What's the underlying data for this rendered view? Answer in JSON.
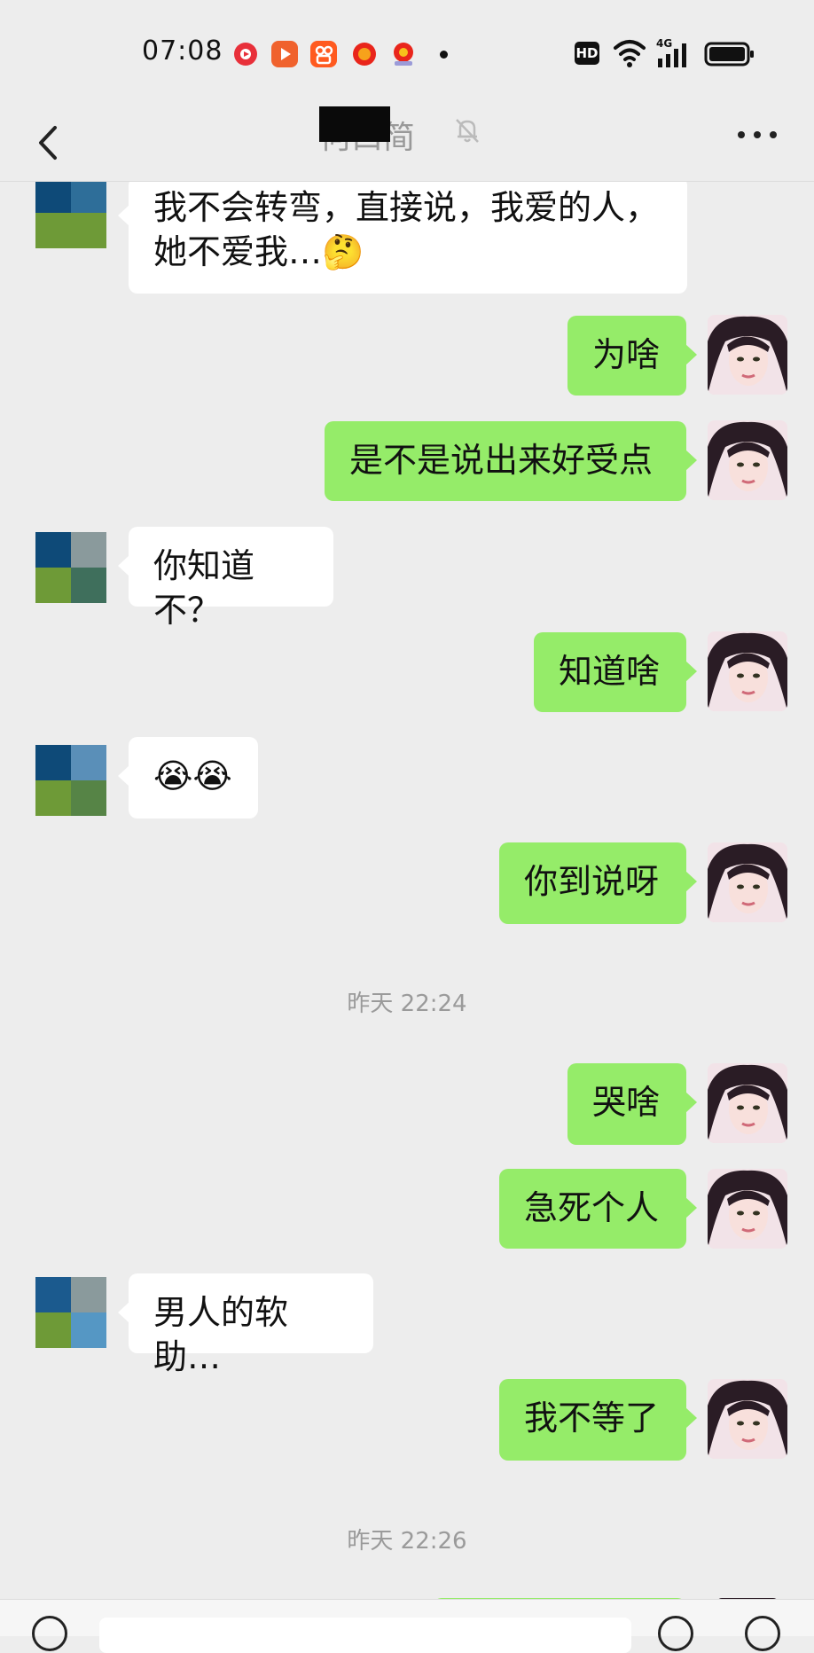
{
  "status_bar": {
    "time": "07:08",
    "network": "4G",
    "hd_label": "HD",
    "icons": [
      "video-app-icon",
      "play-app-icon",
      "kuaishou-app-icon",
      "shopping-app-icon",
      "lottery-app-icon",
      "notification-dot",
      "wifi-icon",
      "signal-icon",
      "battery-icon"
    ]
  },
  "header": {
    "title": "何口简",
    "icons": [
      "back-arrow-icon",
      "mute-bell-icon",
      "more-icon"
    ]
  },
  "messages": [
    {
      "side": "in",
      "text": "我不会转弯，直接说，我爱的人，\n她不爱我…🤔"
    },
    {
      "side": "out",
      "text": "为啥"
    },
    {
      "side": "out",
      "text": "是不是说出来好受点"
    },
    {
      "side": "in",
      "text": "你知道不？"
    },
    {
      "side": "out",
      "text": "知道啥"
    },
    {
      "side": "in",
      "text": "😭😭"
    },
    {
      "side": "out",
      "text": "你到说呀"
    },
    {
      "side": "out",
      "text": "哭啥"
    },
    {
      "side": "out",
      "text": "急死个人"
    },
    {
      "side": "in",
      "text": "男人的软助…"
    },
    {
      "side": "out",
      "text": "我不等了"
    }
  ],
  "timestamps": [
    "昨天 22:24",
    "昨天 22:26"
  ],
  "colors": {
    "background": "#EDEDED",
    "outgoing_bubble": "#95EC69",
    "incoming_bubble": "#FFFFFF",
    "timestamp_text": "#9A9A9A"
  }
}
